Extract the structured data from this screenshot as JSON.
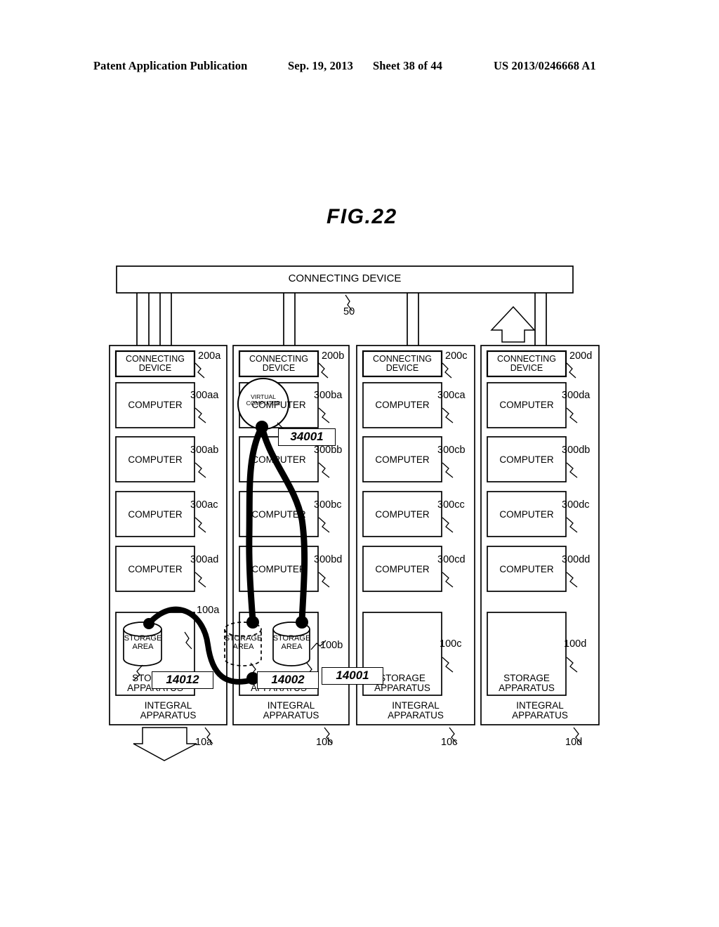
{
  "header": {
    "publication": "Patent Application Publication",
    "date": "Sep. 19, 2013",
    "sheet": "Sheet 38 of 44",
    "number": "US 2013/0246668 A1"
  },
  "figure": {
    "title": "FIG.22"
  },
  "top_bus": {
    "label": "CONNECTING DEVICE",
    "ref": "50"
  },
  "common_labels": {
    "connecting_device": "CONNECTING DEVICE",
    "computer": "COMPUTER",
    "storage_area": "STORAGE AREA",
    "storage_apparatus": "STORAGE APPARATUS",
    "integral_apparatus": "INTEGRAL APPARATUS",
    "virtual_computer": "VIRTUAL COMPUTER"
  },
  "columns": [
    {
      "id": "a",
      "connecting_device_label": "CONNECTING DEVICE",
      "connecting_device_ref": "200a",
      "computers": [
        {
          "label": "COMPUTER",
          "ref": "300aa"
        },
        {
          "label": "COMPUTER",
          "ref": "300ab"
        },
        {
          "label": "COMPUTER",
          "ref": "300ac"
        },
        {
          "label": "COMPUTER",
          "ref": "300ad"
        }
      ],
      "storage_apparatus_ref": "100a",
      "storage_apparatus_label": "STORAGE APPARATUS",
      "storage_areas": [
        {
          "label": "STORAGE AREA",
          "style": "solid"
        }
      ],
      "integral_apparatus_label": "INTEGRAL APPARATUS",
      "integral_apparatus_ref": "10a"
    },
    {
      "id": "b",
      "connecting_device_label": "CONNECTING DEVICE",
      "connecting_device_ref": "200b",
      "computers": [
        {
          "label": "COMPUTER",
          "ref": "300ba"
        },
        {
          "label": "COMPUTER",
          "ref": "300bb"
        },
        {
          "label": "COMPUTER",
          "ref": "300bc"
        },
        {
          "label": "COMPUTER",
          "ref": "300bd"
        }
      ],
      "storage_apparatus_ref": "100b",
      "storage_apparatus_label": "STORAGE APPARATUS",
      "storage_areas": [
        {
          "label": "STORAGE AREA",
          "style": "dashed"
        },
        {
          "label": "STORAGE AREA",
          "style": "solid"
        }
      ],
      "integral_apparatus_label": "INTEGRAL APPARATUS",
      "integral_apparatus_ref": "10b"
    },
    {
      "id": "c",
      "connecting_device_label": "CONNECTING DEVICE",
      "connecting_device_ref": "200c",
      "computers": [
        {
          "label": "COMPUTER",
          "ref": "300ca"
        },
        {
          "label": "COMPUTER",
          "ref": "300cb"
        },
        {
          "label": "COMPUTER",
          "ref": "300cc"
        },
        {
          "label": "COMPUTER",
          "ref": "300cd"
        }
      ],
      "storage_apparatus_ref": "100c",
      "storage_apparatus_label": "STORAGE APPARATUS",
      "storage_areas": [],
      "integral_apparatus_label": "INTEGRAL APPARATUS",
      "integral_apparatus_ref": "10c"
    },
    {
      "id": "d",
      "connecting_device_label": "CONNECTING DEVICE",
      "connecting_device_ref": "200d",
      "computers": [
        {
          "label": "COMPUTER",
          "ref": "300da"
        },
        {
          "label": "COMPUTER",
          "ref": "300db"
        },
        {
          "label": "COMPUTER",
          "ref": "300dc"
        },
        {
          "label": "COMPUTER",
          "ref": "300dd"
        }
      ],
      "storage_apparatus_ref": "100d",
      "storage_apparatus_label": "STORAGE APPARATUS",
      "storage_areas": [],
      "integral_apparatus_label": "INTEGRAL APPARATUS",
      "integral_apparatus_ref": "10d"
    }
  ],
  "virtual_computer": {
    "label": "VIRTUAL COMPUTER",
    "callout": "34001"
  },
  "callouts": {
    "migration_source_area": "14012",
    "migration_target_area": "14002",
    "migration_path": "14001"
  },
  "arrows": {
    "up_arrow": "up-arrow",
    "down_arrow": "down-arrow"
  },
  "colors": {
    "line": "#000000",
    "background": "#ffffff",
    "thick_path": "#000000"
  }
}
